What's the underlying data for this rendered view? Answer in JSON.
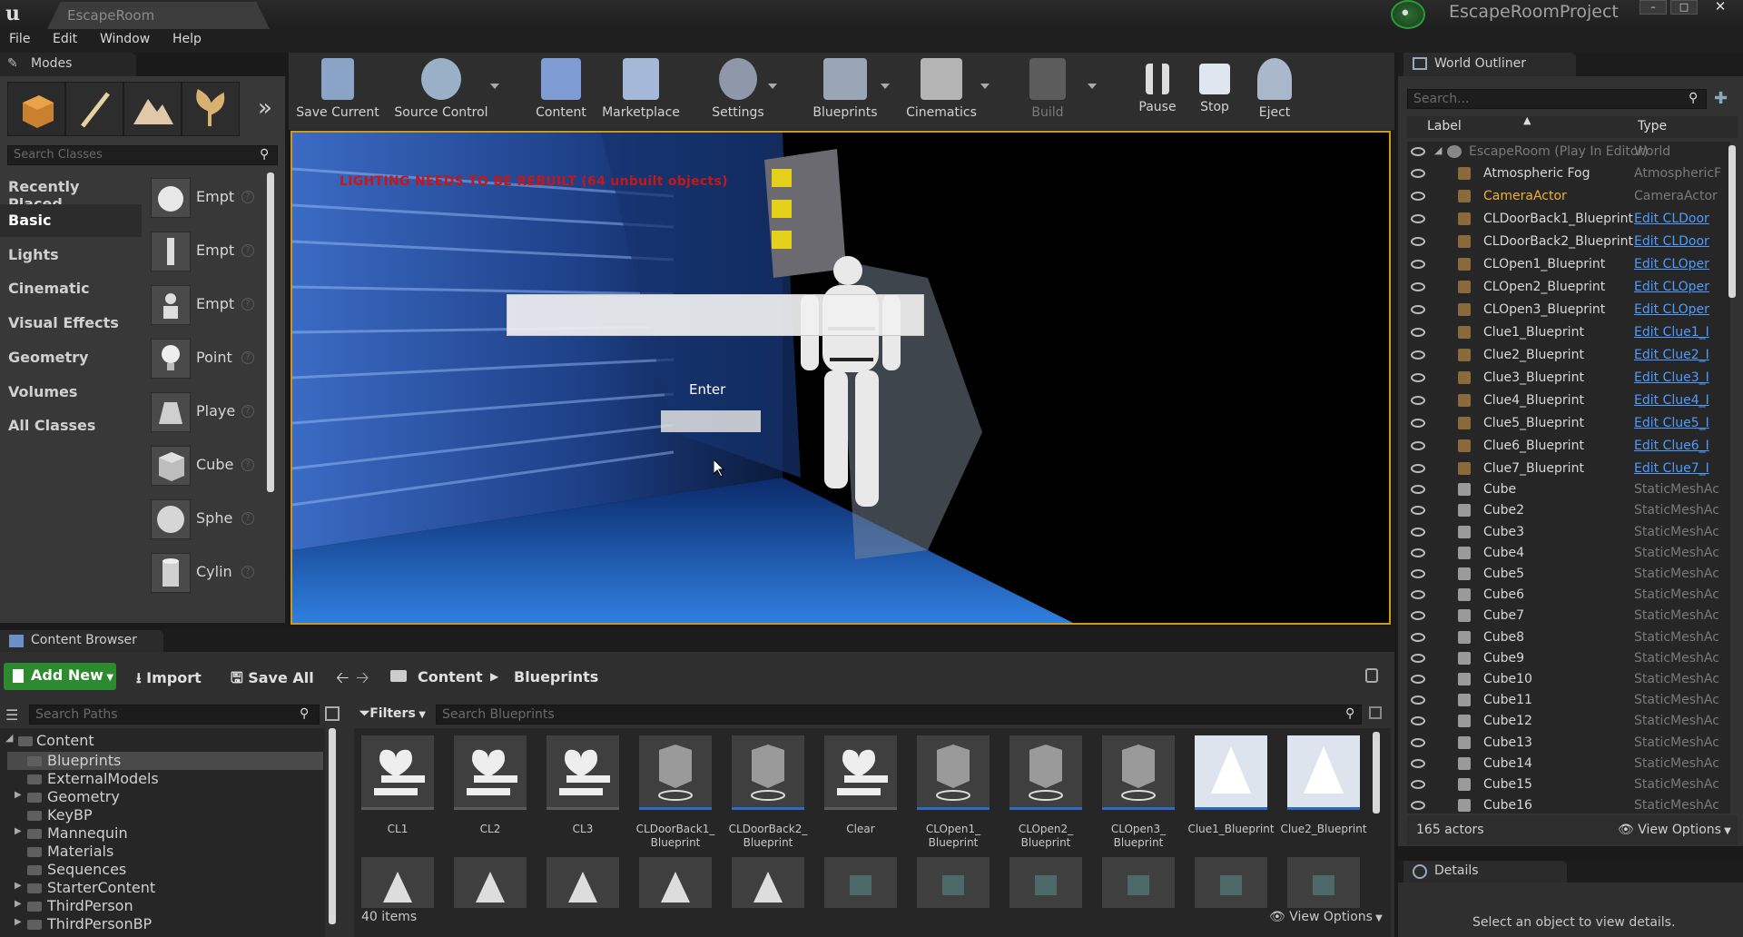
{
  "window": {
    "map_tab": "EscapeRoom",
    "project_name": "EscapeRoomProject",
    "min_label": "–",
    "max_label": "□",
    "close_label": "✕"
  },
  "menu": [
    "File",
    "Edit",
    "Window",
    "Help"
  ],
  "modes": {
    "title": "Modes",
    "search_placeholder": "Search Classes",
    "categories": [
      "Recently Placed",
      "Basic",
      "Lights",
      "Cinematic",
      "Visual Effects",
      "Geometry",
      "Volumes",
      "All Classes"
    ],
    "selected_category": "Basic",
    "place_items": [
      "Empt",
      "Empt",
      "Empt",
      "Point",
      "Playe",
      "Cube",
      "Sphe",
      "Cylin"
    ]
  },
  "toolbar": {
    "save_current": "Save Current",
    "source_control": "Source Control",
    "content": "Content",
    "marketplace": "Marketplace",
    "settings": "Settings",
    "blueprints": "Blueprints",
    "cinematics": "Cinematics",
    "build": "Build",
    "pause": "Pause",
    "stop": "Stop",
    "eject": "Eject"
  },
  "viewport": {
    "lighting_warning": "LIGHTING NEEDS TO BE REBUILT (64 unbuilt objects)",
    "enter_label": "Enter"
  },
  "content_browser": {
    "tab_title": "Content Browser",
    "add_new": "Add New",
    "import": "Import",
    "save_all": "Save All",
    "breadcrumb": [
      "Content",
      "Blueprints"
    ],
    "path_search_placeholder": "Search Paths",
    "filters": "Filters",
    "asset_search_placeholder": "Search Blueprints",
    "folders": [
      "Content",
      "Blueprints",
      "ExternalModels",
      "Geometry",
      "KeyBP",
      "Mannequin",
      "Materials",
      "Sequences",
      "StarterContent",
      "ThirdPerson",
      "ThirdPersonBP"
    ],
    "selected_folder": "Blueprints",
    "assets": [
      "CL1",
      "CL2",
      "CL3",
      "CLDoorBack1_\nBlueprint",
      "CLDoorBack2_\nBlueprint",
      "Clear",
      "CLOpen1_\nBlueprint",
      "CLOpen2_\nBlueprint",
      "CLOpen3_\nBlueprint",
      "Clue1_Blueprint",
      "Clue2_Blueprint"
    ],
    "item_count": "40 items",
    "view_options": "View Options"
  },
  "world_outliner": {
    "tab_title": "World Outliner",
    "search_placeholder": "Search...",
    "col_label": "Label",
    "col_type": "Type",
    "root": {
      "label": "EscapeRoom (Play In Editor)",
      "type": "World"
    },
    "rows": [
      {
        "label": "Atmospheric Fog",
        "type": "AtmosphericF",
        "link": false,
        "highlight": false
      },
      {
        "label": "CameraActor",
        "type": "CameraActor",
        "link": false,
        "highlight": true
      },
      {
        "label": "CLDoorBack1_Blueprint",
        "type": "Edit CLDoor",
        "link": true,
        "highlight": false
      },
      {
        "label": "CLDoorBack2_Blueprint",
        "type": "Edit CLDoor",
        "link": true,
        "highlight": false
      },
      {
        "label": "CLOpen1_Blueprint",
        "type": "Edit CLOper",
        "link": true,
        "highlight": false
      },
      {
        "label": "CLOpen2_Blueprint",
        "type": "Edit CLOper",
        "link": true,
        "highlight": false
      },
      {
        "label": "CLOpen3_Blueprint",
        "type": "Edit CLOper",
        "link": true,
        "highlight": false
      },
      {
        "label": "Clue1_Blueprint",
        "type": "Edit Clue1_I",
        "link": true,
        "highlight": false
      },
      {
        "label": "Clue2_Blueprint",
        "type": "Edit Clue2_I",
        "link": true,
        "highlight": false
      },
      {
        "label": "Clue3_Blueprint",
        "type": "Edit Clue3_I",
        "link": true,
        "highlight": false
      },
      {
        "label": "Clue4_Blueprint",
        "type": "Edit Clue4_I",
        "link": true,
        "highlight": false
      },
      {
        "label": "Clue5_Blueprint",
        "type": "Edit Clue5_I",
        "link": true,
        "highlight": false
      },
      {
        "label": "Clue6_Blueprint",
        "type": "Edit Clue6_I",
        "link": true,
        "highlight": false
      },
      {
        "label": "Clue7_Blueprint",
        "type": "Edit Clue7_I",
        "link": true,
        "highlight": false
      },
      {
        "label": "Cube",
        "type": "StaticMeshAc",
        "link": false,
        "highlight": false
      },
      {
        "label": "Cube2",
        "type": "StaticMeshAc",
        "link": false,
        "highlight": false
      },
      {
        "label": "Cube3",
        "type": "StaticMeshAc",
        "link": false,
        "highlight": false
      },
      {
        "label": "Cube4",
        "type": "StaticMeshAc",
        "link": false,
        "highlight": false
      },
      {
        "label": "Cube5",
        "type": "StaticMeshAc",
        "link": false,
        "highlight": false
      },
      {
        "label": "Cube6",
        "type": "StaticMeshAc",
        "link": false,
        "highlight": false
      },
      {
        "label": "Cube7",
        "type": "StaticMeshAc",
        "link": false,
        "highlight": false
      },
      {
        "label": "Cube8",
        "type": "StaticMeshAc",
        "link": false,
        "highlight": false
      },
      {
        "label": "Cube9",
        "type": "StaticMeshAc",
        "link": false,
        "highlight": false
      },
      {
        "label": "Cube10",
        "type": "StaticMeshAc",
        "link": false,
        "highlight": false
      },
      {
        "label": "Cube11",
        "type": "StaticMeshAc",
        "link": false,
        "highlight": false
      },
      {
        "label": "Cube12",
        "type": "StaticMeshAc",
        "link": false,
        "highlight": false
      },
      {
        "label": "Cube13",
        "type": "StaticMeshAc",
        "link": false,
        "highlight": false
      },
      {
        "label": "Cube14",
        "type": "StaticMeshAc",
        "link": false,
        "highlight": false
      },
      {
        "label": "Cube15",
        "type": "StaticMeshAc",
        "link": false,
        "highlight": false
      },
      {
        "label": "Cube16",
        "type": "StaticMeshAc",
        "link": false,
        "highlight": false
      }
    ],
    "actor_count": "165 actors",
    "view_options": "View Options"
  },
  "details": {
    "tab_title": "Details",
    "empty_message": "Select an object to view details."
  },
  "colors": {
    "accent_green": "#2e8a2e",
    "viewport_border": "#c99a23",
    "link_blue": "#4f9cff",
    "highlight_actor": "#f0b030",
    "warning_red": "#c41818"
  }
}
